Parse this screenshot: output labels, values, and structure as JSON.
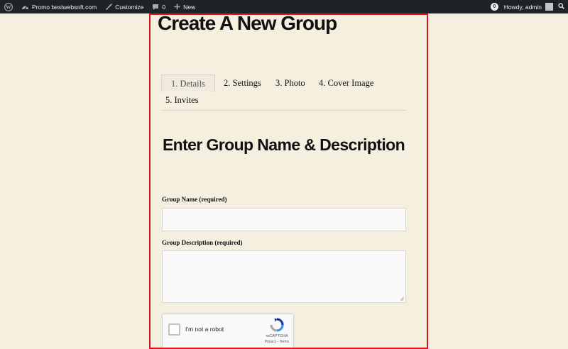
{
  "adminbar": {
    "site_name": "Promo bestwebsoft.com",
    "customize": "Customize",
    "comments_count": "0",
    "new_label": "New",
    "notifications_count": "0",
    "howdy": "Howdy, admin"
  },
  "page": {
    "title": "Create A New Group"
  },
  "tabs": [
    {
      "label": "1. Details",
      "active": true
    },
    {
      "label": "2. Settings",
      "active": false
    },
    {
      "label": "3. Photo",
      "active": false
    },
    {
      "label": "4. Cover Image",
      "active": false
    },
    {
      "label": "5. Invites",
      "active": false
    }
  ],
  "form": {
    "section_title": "Enter Group Name & Description",
    "group_name_label": "Group Name (required)",
    "group_name_value": "",
    "group_description_label": "Group Description (required)",
    "group_description_value": ""
  },
  "captcha": {
    "checkbox_label": "I'm not a robot",
    "brand": "reCAPTCHA",
    "links": "Privacy - Terms"
  },
  "colors": {
    "page_bg": "#f5efe0",
    "adminbar_bg": "#1d2327",
    "highlight_border": "#e0161b"
  }
}
